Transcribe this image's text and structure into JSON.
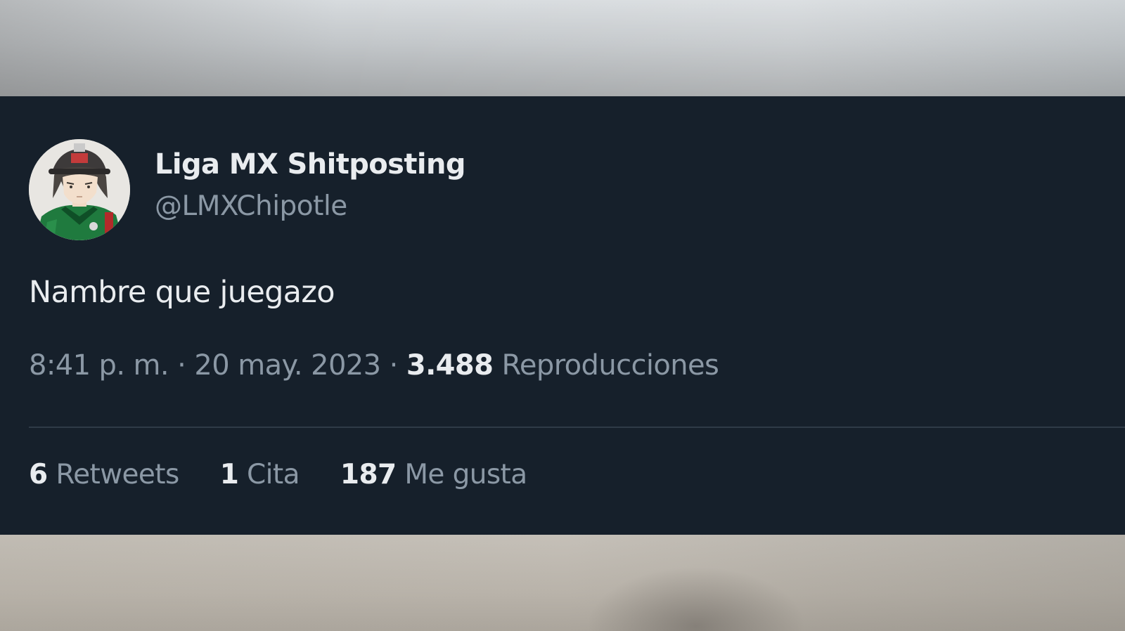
{
  "tweet": {
    "author": {
      "display_name": "Liga MX Shitposting",
      "handle": "@LMXChipotle"
    },
    "text": "Nambre que juegazo",
    "meta": {
      "time": "8:41 p. m.",
      "separator": " · ",
      "date": "20 may. 2023",
      "views_count": "3.488",
      "views_label": "Reproducciones"
    },
    "stats": {
      "retweets_count": "6",
      "retweets_label": "Retweets",
      "quotes_count": "1",
      "quotes_label": "Cita",
      "likes_count": "187",
      "likes_label": "Me gusta"
    }
  },
  "colors": {
    "card_background": "#16202b",
    "primary_text": "#e9ecef",
    "secondary_text": "#8b98a5",
    "divider": "#2f3b47"
  }
}
